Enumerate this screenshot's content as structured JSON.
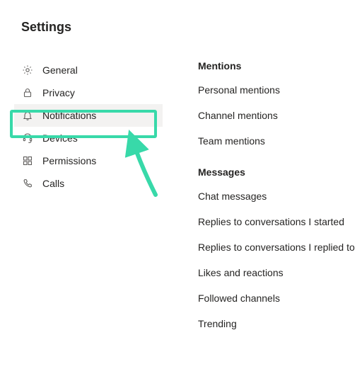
{
  "page": {
    "title": "Settings"
  },
  "sidebar": {
    "items": [
      {
        "label": "General"
      },
      {
        "label": "Privacy"
      },
      {
        "label": "Notifications"
      },
      {
        "label": "Devices"
      },
      {
        "label": "Permissions"
      },
      {
        "label": "Calls"
      }
    ]
  },
  "content": {
    "sections": [
      {
        "title": "Mentions",
        "rows": [
          "Personal mentions",
          "Channel mentions",
          "Team mentions"
        ]
      },
      {
        "title": "Messages",
        "rows": [
          "Chat messages",
          "Replies to conversations I started",
          "Replies to conversations I replied to",
          "Likes and reactions",
          "Followed channels",
          "Trending"
        ]
      }
    ]
  }
}
